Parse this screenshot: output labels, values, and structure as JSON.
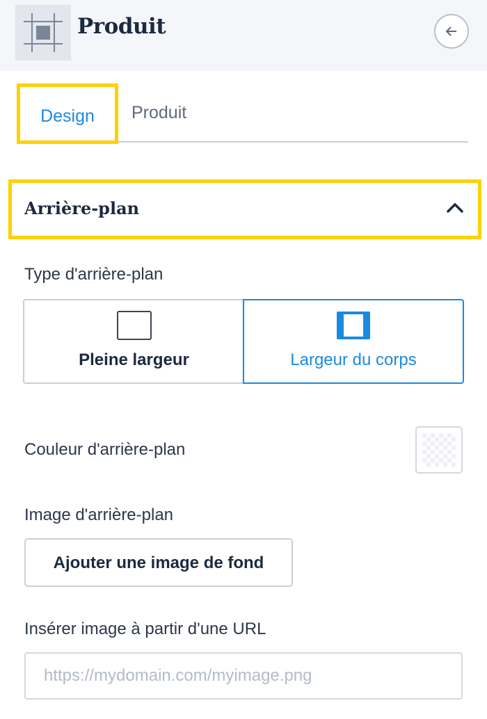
{
  "header": {
    "title": "Produit",
    "block_icon": "block-frame-icon",
    "back_icon": "arrow-left-icon"
  },
  "tabs": [
    {
      "label": "Design",
      "active": true
    },
    {
      "label": "Produit",
      "active": false
    }
  ],
  "section": {
    "title": "Arrière-plan",
    "expanded": true,
    "toggle_icon": "chevron-up-icon"
  },
  "background_type": {
    "label": "Type d'arrière-plan",
    "options": [
      {
        "label": "Pleine largeur",
        "icon": "full-width-icon",
        "selected": false
      },
      {
        "label": "Largeur du corps",
        "icon": "body-width-icon",
        "selected": true
      }
    ]
  },
  "background_color": {
    "label": "Couleur d'arrière-plan",
    "swatch_icon": "transparent-swatch-icon"
  },
  "background_image": {
    "label": "Image d'arrière-plan",
    "button_label": "Ajouter une image de fond"
  },
  "image_url": {
    "label": "Insérer image à partir d'une URL",
    "placeholder": "https://mydomain.com/myimage.png",
    "value": ""
  },
  "colors": {
    "accent": "#1a8ae0",
    "highlight": "#ffd100",
    "text_dark": "#1c2a3f"
  }
}
